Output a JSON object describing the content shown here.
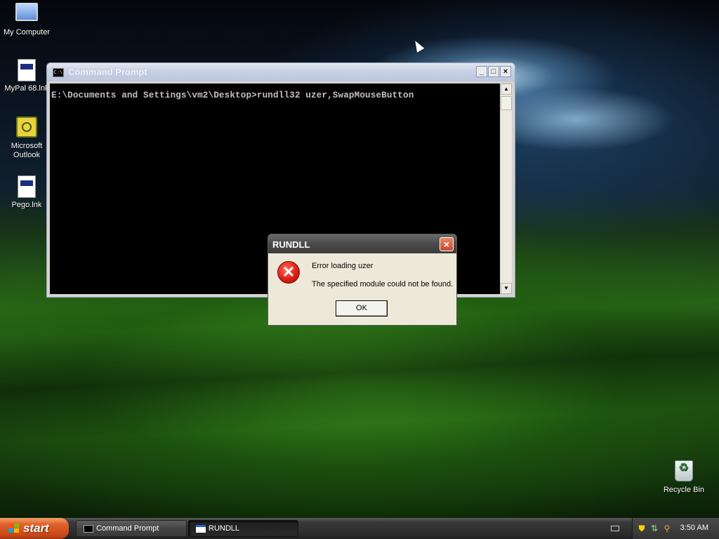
{
  "desktop": {
    "icons": [
      {
        "label": "My Computer",
        "icon": "my-computer-icon"
      },
      {
        "label": "MyPal 68.lnk",
        "icon": "shortcut-file-icon"
      },
      {
        "label": "Microsoft Outlook",
        "icon": "outlook-icon"
      },
      {
        "label": "Pego.lnk",
        "icon": "shortcut-file-icon"
      },
      {
        "label": "Recycle Bin",
        "icon": "recycle-bin-icon"
      }
    ]
  },
  "cmd_window": {
    "title": "Command Prompt",
    "icon_text": "C:\\",
    "controls": {
      "minimize": "_",
      "maximize": "□",
      "close": "×"
    },
    "content_line": "E:\\Documents and Settings\\vm2\\Desktop>rundll32 uzer,SwapMouseButton",
    "scroll_up": "▲",
    "scroll_down": "▼"
  },
  "dialog": {
    "title": "RUNDLL",
    "close": "×",
    "icon": "error-icon",
    "icon_glyph": "✕",
    "message_title": "Error loading uzer",
    "message_body": "The specified module could not be found.",
    "ok_label": "OK"
  },
  "taskbar": {
    "start_label": "start",
    "tasks": [
      {
        "label": "Command Prompt",
        "active": false
      },
      {
        "label": "RUNDLL",
        "active": true
      }
    ],
    "clock": "3:50 AM",
    "colors": {
      "start_green": "#3c8d2f",
      "flag_red": "#f25022",
      "flag_green": "#7fba00",
      "flag_blue": "#00a4ef",
      "flag_yellow": "#ffb900"
    }
  }
}
